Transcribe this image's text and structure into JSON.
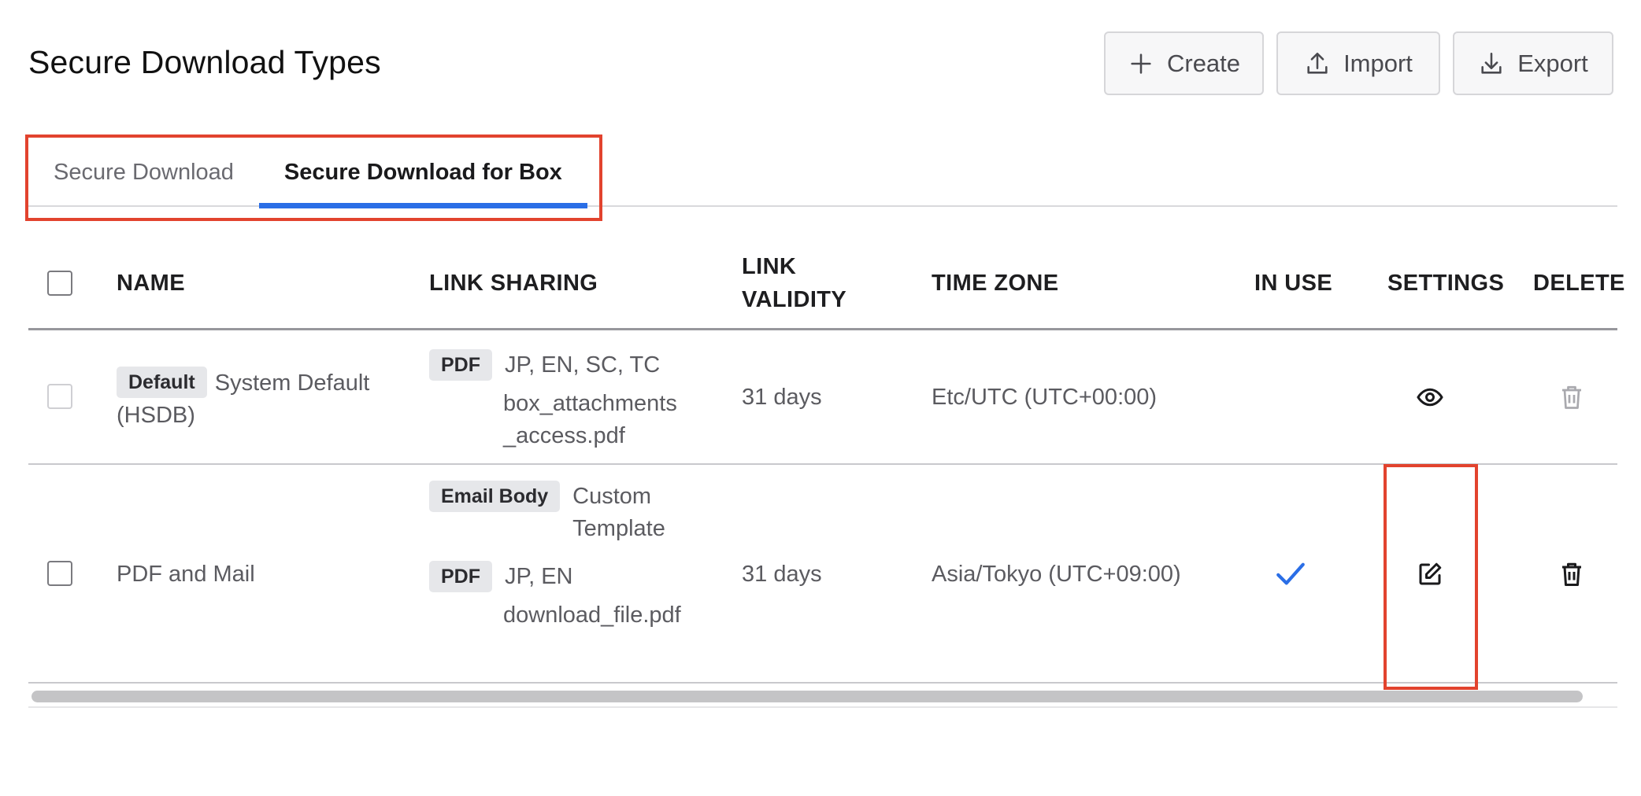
{
  "page": {
    "title": "Secure Download Types"
  },
  "toolbar": {
    "create_label": "Create",
    "import_label": "Import",
    "export_label": "Export"
  },
  "tabs": [
    {
      "label": "Secure Download",
      "active": false
    },
    {
      "label": "Secure Download for Box",
      "active": true
    }
  ],
  "table": {
    "headers": {
      "name": "NAME",
      "link_sharing": "LINK SHARING",
      "link_validity_1": "LINK",
      "link_validity_2": "VALIDITY",
      "time_zone": "TIME ZONE",
      "in_use": "IN USE",
      "settings": "SETTINGS",
      "delete": "DELETE"
    },
    "rows": [
      {
        "badge": "Default",
        "name": "System Default (HSDB)",
        "pdf_tag": "PDF",
        "pdf_languages": "JP, EN, SC, TC",
        "pdf_file": "box_attachments_access.pdf",
        "link_validity": "31 days",
        "time_zone": "Etc/UTC (UTC+00:00)",
        "in_use": false,
        "settings_icon": "eye-icon",
        "delete_icon": "trash-icon"
      },
      {
        "name": "PDF and Mail",
        "email_tag": "Email Body",
        "email_template": "Custom Template",
        "pdf_tag": "PDF",
        "pdf_languages": "JP, EN",
        "pdf_file": "download_file.pdf",
        "link_validity": "31 days",
        "time_zone": "Asia/Tokyo (UTC+09:00)",
        "in_use": true,
        "settings_icon": "edit-icon",
        "delete_icon": "trash-icon"
      }
    ]
  },
  "colors": {
    "accent": "#2a6ee6",
    "highlight": "#e2432e",
    "check": "#2a6ee6"
  }
}
